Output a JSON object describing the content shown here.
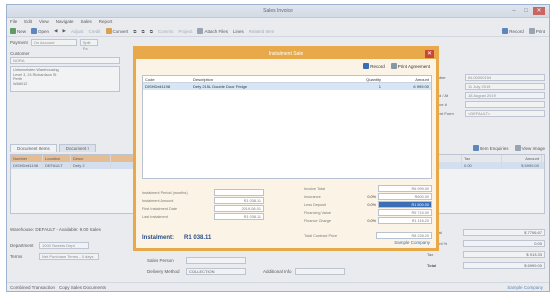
{
  "window": {
    "title": "Sales Invoice",
    "min": "–",
    "max": "□",
    "close": "✕"
  },
  "menu": [
    "File",
    "Edit",
    "View",
    "Navigate",
    "Sales",
    "Report"
  ],
  "toolbar": {
    "items": [
      "New",
      "Open",
      "◀",
      "▶",
      "Adjust",
      "Credit",
      "Convert",
      "⧉",
      "⧉",
      "⧉",
      "Comms",
      "Project",
      "Attach Files",
      "Lines",
      "Related Item"
    ],
    "record": "Record",
    "print": "Print"
  },
  "payment": {
    "label": "Payment",
    "value": "On Account",
    "split": "Split Pa"
  },
  "customer": {
    "label": "Customer",
    "value": "NORA",
    "address": [
      "Unfunnelsten Warehousing",
      "Level 3, 24 Richardson St",
      "Perth",
      "WA6012"
    ]
  },
  "right_fields": [
    {
      "label": "Inv Number",
      "value": "IN-00000194"
    },
    {
      "label": "Date",
      "value": "11 July 2019"
    },
    {
      "label": "Required / At",
      "value": "18 August 2019"
    },
    {
      "label": "Reference #",
      "value": ""
    },
    {
      "label": "Document Form",
      "value": "<DEFAULT>"
    }
  ],
  "tabs": [
    "Document Items",
    "Document I"
  ],
  "left_grid": {
    "headers": [
      "Number",
      "Location",
      "Descr"
    ],
    "row": [
      "DISHDeli1198",
      "DEFAULT",
      "Defy 2"
    ]
  },
  "right_grid": {
    "toolbar": [
      "Item Enquiries",
      "View Image"
    ],
    "headers": [
      "Disc",
      "Tax",
      "Amount"
    ],
    "row": [
      "",
      "0.00",
      "$ 6999.00"
    ]
  },
  "bottom_left": {
    "warehouse": "Warehouse: DEFAULT - Available: 9.00  Sales",
    "department_label": "Department",
    "department": "1000 Sweets Dept",
    "terms_label": "Terms",
    "terms": "Net Purchase Terms - 0 days"
  },
  "bottom_center": {
    "sales_person_label": "Sales Person",
    "sales_person": "",
    "delivery_label": "Delivery Method",
    "delivery": "COLLECTION",
    "additional_label": "Additional Info",
    "additional": ""
  },
  "totals": [
    {
      "label": "Subtotal",
      "value": "$ 7706.67"
    },
    {
      "label": "Discount %",
      "value": "0.00"
    },
    {
      "label": "Tax",
      "value": "$ 913.33"
    },
    {
      "label": "Total",
      "value": "$ 6999.00"
    }
  ],
  "statusbar": {
    "transaction": "Combined Transaction",
    "copy": "Copy Sales Documents",
    "company": "Sample Company"
  },
  "dialog": {
    "title": "Instalment Sale",
    "record": "Record",
    "print": "Print Agreement",
    "headers": [
      "Code",
      "Description",
      "Quantity",
      "Amount"
    ],
    "row": [
      "DISHDeli1198",
      "Defy 215L Double Door Fridge",
      "1",
      "6 999.00"
    ],
    "left_fields": [
      {
        "label": "Instalment Period (months)",
        "value": ""
      },
      {
        "label": "Instalment Amount",
        "value": "R1 038.11"
      },
      {
        "label": "First Instalment Date",
        "value": "2019-08-01"
      },
      {
        "label": "Last Instalment",
        "value": "R1 038.11"
      }
    ],
    "instalment_label": "Instalment:",
    "instalment_value": "R1 038.11",
    "right_fields": [
      {
        "label": "Invoice Total",
        "pct": "",
        "value": "R6 999.00"
      },
      {
        "label": "Insurance",
        "pct": "0.0%",
        "value": "R600.00"
      },
      {
        "label": "Less Deposit",
        "pct": "0.0%",
        "value": "R1 500.00",
        "selected": true
      },
      {
        "label": "Financing Value",
        "pct": "",
        "value": "R5 715.00"
      },
      {
        "label": "Finance Charge",
        "pct": "0.0%",
        "value": "R1 116.20"
      }
    ],
    "total_label": "Total Contract Price",
    "total_value": "R8 228.20",
    "company": "Sample Company"
  }
}
